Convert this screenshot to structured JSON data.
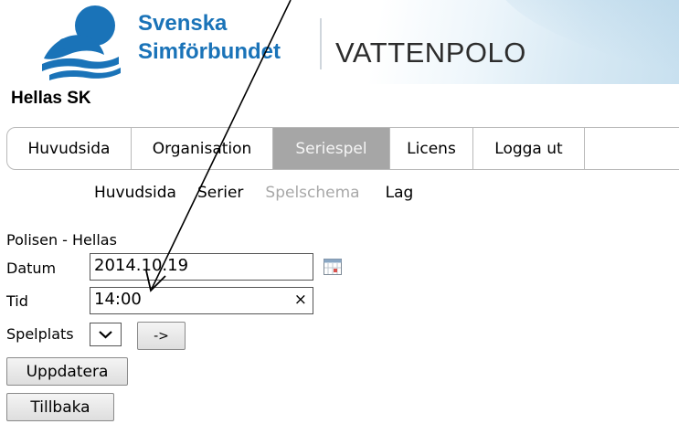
{
  "header": {
    "brand_line1": "Svenska",
    "brand_line2": "Simförbundet",
    "section_title": "VATTENPOLO",
    "logo_icon": "swimmer-logo-icon",
    "brand_color": "#1a73b8"
  },
  "club": {
    "name": "Hellas SK"
  },
  "main_nav": {
    "tabs": [
      {
        "label": "Huvudsida"
      },
      {
        "label": "Organisation"
      },
      {
        "label": "Seriespel",
        "active": true
      },
      {
        "label": "Licens"
      },
      {
        "label": "Logga ut"
      }
    ],
    "active_color": "#a6a6a6"
  },
  "sub_nav": {
    "items": [
      {
        "label": "Huvudsida"
      },
      {
        "label": "Serier"
      },
      {
        "label": "Spelschema",
        "disabled": true
      },
      {
        "label": "Lag"
      }
    ]
  },
  "match": {
    "title": "Polisen - Hellas",
    "date_label": "Datum",
    "date_value": "2014.10.19",
    "time_label": "Tid",
    "time_value": "14:00",
    "time_clear": "×",
    "venue_label": "Spelplats",
    "venue_go": "->",
    "update_button": "Uppdatera",
    "back_button": "Tillbaka"
  },
  "annotation": {
    "icon": "arrow-annotation-icon"
  }
}
